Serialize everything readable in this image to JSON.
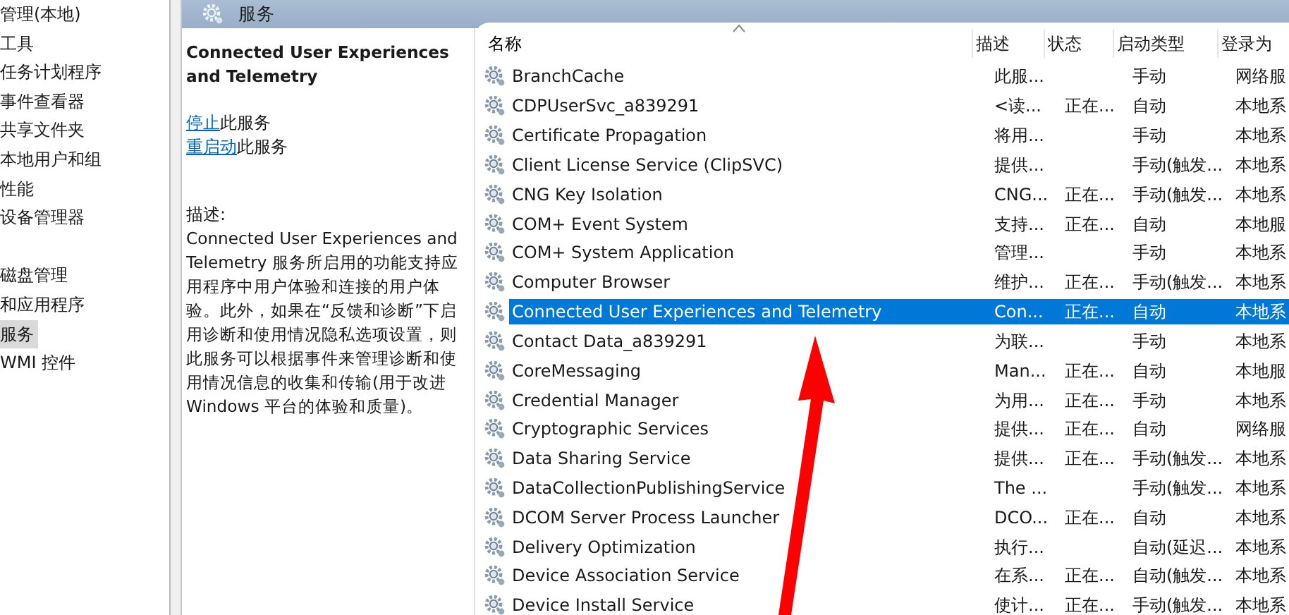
{
  "tree": {
    "items": [
      {
        "label": "管理(本地)",
        "selected": false
      },
      {
        "label": "工具",
        "selected": false
      },
      {
        "label": "任务计划程序",
        "selected": false
      },
      {
        "label": "事件查看器",
        "selected": false
      },
      {
        "label": "共享文件夹",
        "selected": false
      },
      {
        "label": "本地用户和组",
        "selected": false
      },
      {
        "label": "性能",
        "selected": false
      },
      {
        "label": "设备管理器",
        "selected": false
      },
      {
        "label": "磁盘管理",
        "selected": false
      },
      {
        "label": "和应用程序",
        "selected": false
      },
      {
        "label": "服务",
        "selected": true
      },
      {
        "label": "WMI 控件",
        "selected": false
      }
    ]
  },
  "pane_title": "服务",
  "detail": {
    "title": "Connected User Experiences and Telemetry",
    "actions": [
      {
        "link": "停止",
        "text": "此服务"
      },
      {
        "link": "重启动",
        "text": "此服务"
      }
    ],
    "description_label": "描述:",
    "description": "Connected User Experiences and Telemetry 服务所启用的功能支持应用程序中用户体验和连接的用户体验。此外，如果在“反馈和诊断”下启用诊断和使用情况隐私选项设置，则此服务可以根据事件来管理诊断和使用情况信息的收集和传输(用于改进 Windows 平台的体验和质量)。"
  },
  "table": {
    "columns": [
      {
        "label": "名称",
        "sorted": true
      },
      {
        "label": "描述",
        "sorted": false
      },
      {
        "label": "状态",
        "sorted": false
      },
      {
        "label": "启动类型",
        "sorted": false
      },
      {
        "label": "登录为",
        "sorted": false
      }
    ],
    "rows": [
      {
        "name": "BranchCache",
        "description": "此服...",
        "status": "",
        "startup": "手动",
        "logon": "网络服",
        "selected": false
      },
      {
        "name": "CDPUserSvc_a839291",
        "description": "<读...",
        "status": "正在...",
        "startup": "自动",
        "logon": "本地系",
        "selected": false
      },
      {
        "name": "Certificate Propagation",
        "description": "将用...",
        "status": "",
        "startup": "手动",
        "logon": "本地系",
        "selected": false
      },
      {
        "name": "Client License Service (ClipSVC)",
        "description": "提供...",
        "status": "",
        "startup": "手动(触发...",
        "logon": "本地系",
        "selected": false
      },
      {
        "name": "CNG Key Isolation",
        "description": "CNG...",
        "status": "正在...",
        "startup": "手动(触发...",
        "logon": "本地系",
        "selected": false
      },
      {
        "name": "COM+ Event System",
        "description": "支持...",
        "status": "正在...",
        "startup": "自动",
        "logon": "本地服",
        "selected": false
      },
      {
        "name": "COM+ System Application",
        "description": "管理...",
        "status": "",
        "startup": "手动",
        "logon": "本地系",
        "selected": false
      },
      {
        "name": "Computer Browser",
        "description": "维护...",
        "status": "正在...",
        "startup": "手动(触发...",
        "logon": "本地系",
        "selected": false
      },
      {
        "name": "Connected User Experiences and Telemetry",
        "description": "Con...",
        "status": "正在...",
        "startup": "自动",
        "logon": "本地系",
        "selected": true
      },
      {
        "name": "Contact Data_a839291",
        "description": "为联...",
        "status": "",
        "startup": "手动",
        "logon": "本地系",
        "selected": false
      },
      {
        "name": "CoreMessaging",
        "description": "Man...",
        "status": "正在...",
        "startup": "自动",
        "logon": "本地服",
        "selected": false
      },
      {
        "name": "Credential Manager",
        "description": "为用...",
        "status": "正在...",
        "startup": "手动",
        "logon": "本地系",
        "selected": false
      },
      {
        "name": "Cryptographic Services",
        "description": "提供...",
        "status": "正在...",
        "startup": "自动",
        "logon": "网络服",
        "selected": false
      },
      {
        "name": "Data Sharing Service",
        "description": "提供...",
        "status": "正在...",
        "startup": "手动(触发...",
        "logon": "本地系",
        "selected": false
      },
      {
        "name": "DataCollectionPublishingService",
        "description": "The ...",
        "status": "",
        "startup": "手动(触发...",
        "logon": "本地系",
        "selected": false
      },
      {
        "name": "DCOM Server Process Launcher",
        "description": "DCO...",
        "status": "正在...",
        "startup": "自动",
        "logon": "本地系",
        "selected": false
      },
      {
        "name": "Delivery Optimization",
        "description": "执行...",
        "status": "",
        "startup": "自动(延迟...",
        "logon": "本地系",
        "selected": false
      },
      {
        "name": "Device Association Service",
        "description": "在系...",
        "status": "正在...",
        "startup": "自动(触发...",
        "logon": "本地系",
        "selected": false
      },
      {
        "name": "Device Install Service",
        "description": "使计...",
        "status": "正在...",
        "startup": "手动(触发...",
        "logon": "本地系",
        "selected": false
      }
    ]
  },
  "annotations": [
    {
      "kind": "arrow",
      "color": "#ff0000"
    }
  ]
}
